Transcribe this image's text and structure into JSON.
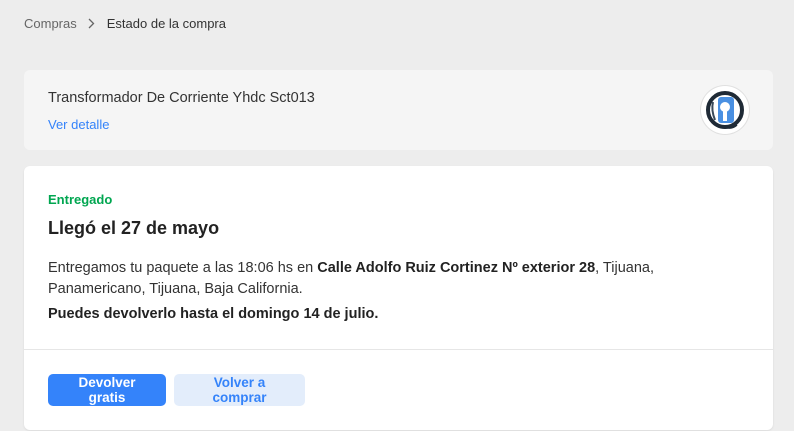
{
  "breadcrumb": {
    "parent": "Compras",
    "current": "Estado de la compra"
  },
  "product": {
    "title": "Transformador De Corriente Yhdc Sct013",
    "detail_link": "Ver detalle",
    "thumbnail_icon": "current-transformer-clamp-icon"
  },
  "status": {
    "label": "Entregado",
    "title": "Llegó el 27 de mayo",
    "desc_prefix": "Entregamos tu paquete a las 18:06 hs en ",
    "desc_address": "Calle Adolfo Ruiz Cortinez Nº exterior 28",
    "desc_suffix": ", Tijuana, Panamericano, Tijuana, Baja California.",
    "return_prefix": "Puedes devolverlo hasta el domingo ",
    "return_day": "14",
    "return_suffix": " de julio."
  },
  "actions": {
    "return_button": "Devolver gratis",
    "buy_again_button": "Volver a comprar"
  },
  "colors": {
    "accent": "#3483fa",
    "success": "#00a650",
    "background": "#ededed"
  }
}
